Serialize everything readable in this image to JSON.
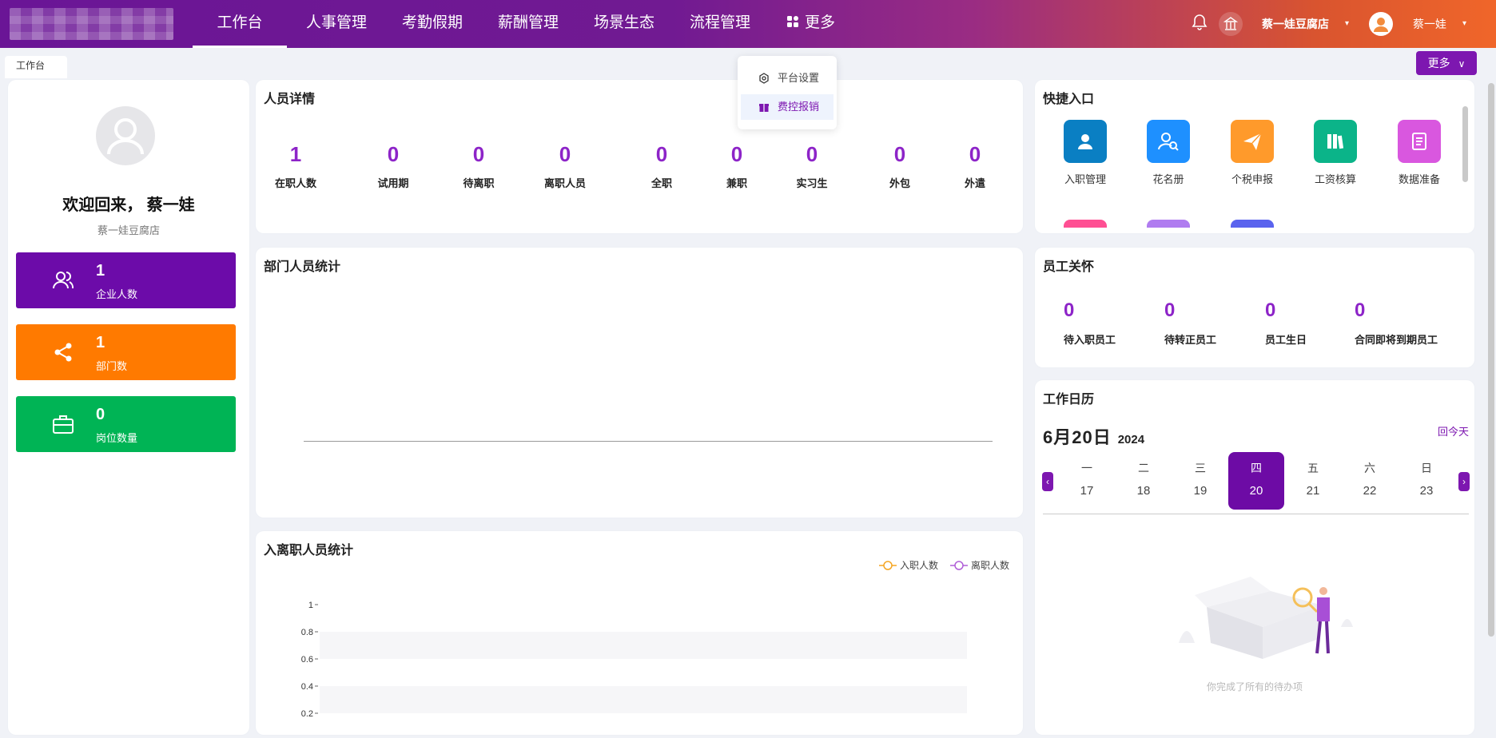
{
  "nav": {
    "items": [
      "工作台",
      "人事管理",
      "考勤假期",
      "薪酬管理",
      "场景生态",
      "流程管理"
    ],
    "more_label": "更多",
    "store": "蔡一娃豆腐店",
    "user": "蔡一娃"
  },
  "breadcrumb": "工作台",
  "more_button": "更多",
  "dropdown": [
    "平台设置",
    "费控报销"
  ],
  "profile": {
    "welcome": "欢迎回来， 蔡一娃",
    "store": "蔡一娃豆腐店",
    "stats": [
      {
        "value": "1",
        "label": "企业人数",
        "color": "#6c0ba9",
        "icon": "users-icon"
      },
      {
        "value": "1",
        "label": "部门数",
        "color": "#ff7a00",
        "icon": "share-icon"
      },
      {
        "value": "0",
        "label": "岗位数量",
        "color": "#00b455",
        "icon": "briefcase-icon"
      }
    ]
  },
  "people": {
    "title": "人员详情",
    "items": [
      {
        "value": "1",
        "label": "在职人数"
      },
      {
        "value": "0",
        "label": "试用期"
      },
      {
        "value": "0",
        "label": "待离职"
      },
      {
        "value": "0",
        "label": "离职人员"
      },
      {
        "value": "0",
        "label": "全职"
      },
      {
        "value": "0",
        "label": "兼职"
      },
      {
        "value": "0",
        "label": "实习生"
      },
      {
        "value": "0",
        "label": "外包"
      },
      {
        "value": "0",
        "label": "外遣"
      }
    ]
  },
  "dept": {
    "title": "部门人员统计"
  },
  "entry_exit": {
    "title": "入离职人员统计"
  },
  "quick": {
    "title": "快捷入口",
    "items": [
      {
        "label": "入职管理",
        "color": "#0a7fc3"
      },
      {
        "label": "花名册",
        "color": "#1e90ff"
      },
      {
        "label": "个税申报",
        "color": "#ff9a2b"
      },
      {
        "label": "工资核算",
        "color": "#0bb489"
      },
      {
        "label": "数据准备",
        "color": "#d957df"
      }
    ],
    "partial_colors": [
      "#ff4f93",
      "#b07cf0",
      "#5a63ee"
    ]
  },
  "care": {
    "title": "员工关怀",
    "items": [
      {
        "value": "0",
        "label": "待入职员工"
      },
      {
        "value": "0",
        "label": "待转正员工"
      },
      {
        "value": "0",
        "label": "员工生日"
      },
      {
        "value": "0",
        "label": "合同即将到期员工"
      }
    ]
  },
  "calendar": {
    "title": "工作日历",
    "date": "6月20日",
    "year": "2024",
    "today": "回今天",
    "days": [
      {
        "wd": "一",
        "d": "17"
      },
      {
        "wd": "二",
        "d": "18"
      },
      {
        "wd": "三",
        "d": "19"
      },
      {
        "wd": "四",
        "d": "20"
      },
      {
        "wd": "五",
        "d": "21"
      },
      {
        "wd": "六",
        "d": "22"
      },
      {
        "wd": "日",
        "d": "23"
      }
    ],
    "empty": "你完成了所有的待办项"
  },
  "chart_data": {
    "type": "line",
    "title": "入离职人员统计",
    "series": [
      {
        "name": "入职人数",
        "color": "#f5a623",
        "values": []
      },
      {
        "name": "离职人数",
        "color": "#b05ed8",
        "values": []
      }
    ],
    "yticks": [
      "1",
      "0.8",
      "0.6",
      "0.4",
      "0.2"
    ],
    "ylim": [
      0,
      1
    ],
    "grid": "banded",
    "legend": "top-right"
  }
}
